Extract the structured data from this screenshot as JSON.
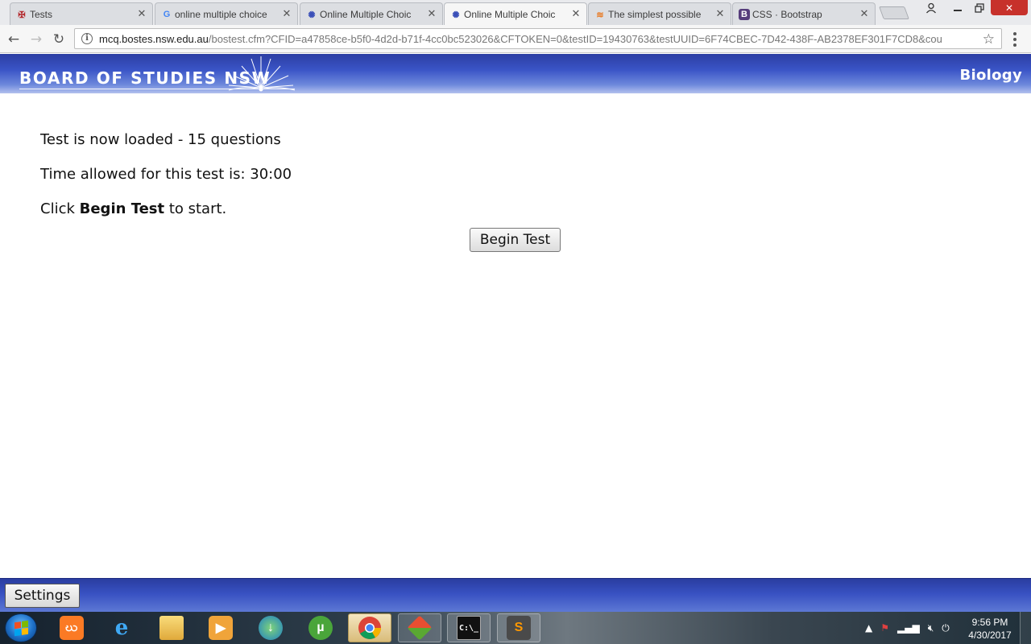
{
  "browser": {
    "tabs": [
      {
        "title": "Tests",
        "favicon": "red-cross-icon",
        "active": false
      },
      {
        "title": "online multiple choice",
        "favicon": "google-icon",
        "active": false
      },
      {
        "title": "Online Multiple Choic",
        "favicon": "bos-icon",
        "active": false
      },
      {
        "title": "Online Multiple Choic",
        "favicon": "bos-icon",
        "active": true
      },
      {
        "title": "The simplest possible",
        "favicon": "stackoverflow-icon",
        "active": false
      },
      {
        "title": "CSS · Bootstrap",
        "favicon": "bootstrap-icon",
        "active": false
      }
    ],
    "url_host": "mcq.bostes.nsw.edu.au",
    "url_path": "/bostest.cfm?CFID=a47858ce-b5f0-4d2d-b71f-4cc0bc523026&CFTOKEN=0&testID=19430763&testUUID=6F74CBEC-7D42-438F-AB2378EF301F7CD8&cou"
  },
  "header": {
    "logo_text": "BOARD OF STUDIES NSW",
    "subject": "Biology"
  },
  "content": {
    "loaded_text": "Test is now loaded - 15 questions",
    "time_text": "Time allowed for this test is: 30:00",
    "click_prefix": "Click ",
    "click_bold": "Begin Test",
    "click_suffix": " to start.",
    "begin_button": "Begin Test"
  },
  "footer": {
    "settings_button": "Settings"
  },
  "taskbar": {
    "apps": [
      "xampp",
      "internet-explorer",
      "file-explorer",
      "media-player",
      "internet-download-manager",
      "utorrent",
      "chrome",
      "git",
      "command-prompt",
      "sublime-text"
    ],
    "clock_time": "9:56 PM",
    "clock_date": "4/30/2017"
  },
  "colors": {
    "header_blue": "#2c3ea3",
    "close_red": "#c7312b"
  }
}
